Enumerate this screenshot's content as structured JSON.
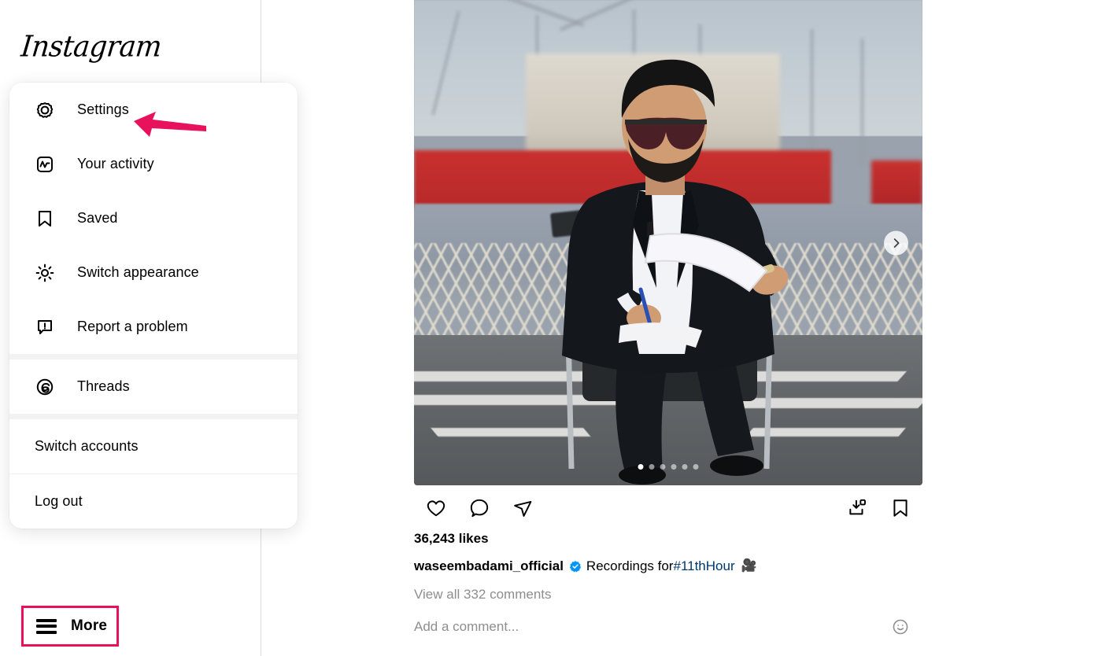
{
  "app": {
    "brand": "Instagram"
  },
  "sidebar": {
    "more_button": {
      "label": "More",
      "icon": "hamburger-menu-icon",
      "highlight_color": "#e8125c"
    }
  },
  "annotations": {
    "settings_arrow": {
      "icon": "left-pointing-arrow-icon",
      "color": "#e8125c",
      "points_to": "Settings"
    }
  },
  "menu": {
    "groups": [
      {
        "items": [
          {
            "label": "Settings",
            "icon": "gear-icon"
          },
          {
            "label": "Your activity",
            "icon": "activity-chart-icon"
          },
          {
            "label": "Saved",
            "icon": "bookmark-icon"
          },
          {
            "label": "Switch appearance",
            "icon": "sun-icon"
          },
          {
            "label": "Report a problem",
            "icon": "report-problem-icon"
          }
        ]
      },
      {
        "items": [
          {
            "label": "Threads",
            "icon": "threads-icon"
          }
        ]
      },
      {
        "items": [
          {
            "label": "Switch accounts",
            "icon": null
          },
          {
            "label": "Log out",
            "icon": null
          }
        ]
      }
    ]
  },
  "post": {
    "media": {
      "alt": "Man in a black suit and sunglasses seated on a chair on a ship deck reading papers, cargo ships and dockyard cranes blurred behind",
      "carousel": {
        "total_slides": 6,
        "active_slide": 1,
        "next_button_icon": "chevron-right-icon"
      }
    },
    "actions": {
      "like": {
        "label": "Like",
        "icon": "heart-icon"
      },
      "comment": {
        "label": "Comment",
        "icon": "comment-bubble-icon"
      },
      "share": {
        "label": "Share",
        "icon": "paper-plane-icon"
      },
      "download": {
        "label": "Download",
        "icon": "download-icon"
      },
      "save": {
        "label": "Save",
        "icon": "bookmark-icon"
      }
    },
    "likes": "36,243 likes",
    "caption": {
      "username": "waseembadami_official",
      "verified": true,
      "verified_badge_color": "#0095f6",
      "verified_icon": "verified-badge-icon",
      "text": "Recordings for ",
      "hashtag": "#11thHour",
      "emoji": "🎥"
    },
    "view_comments": "View all 332 comments",
    "comment_box": {
      "placeholder": "Add a comment...",
      "value": "",
      "emoji_button_icon": "smiley-face-icon"
    }
  }
}
